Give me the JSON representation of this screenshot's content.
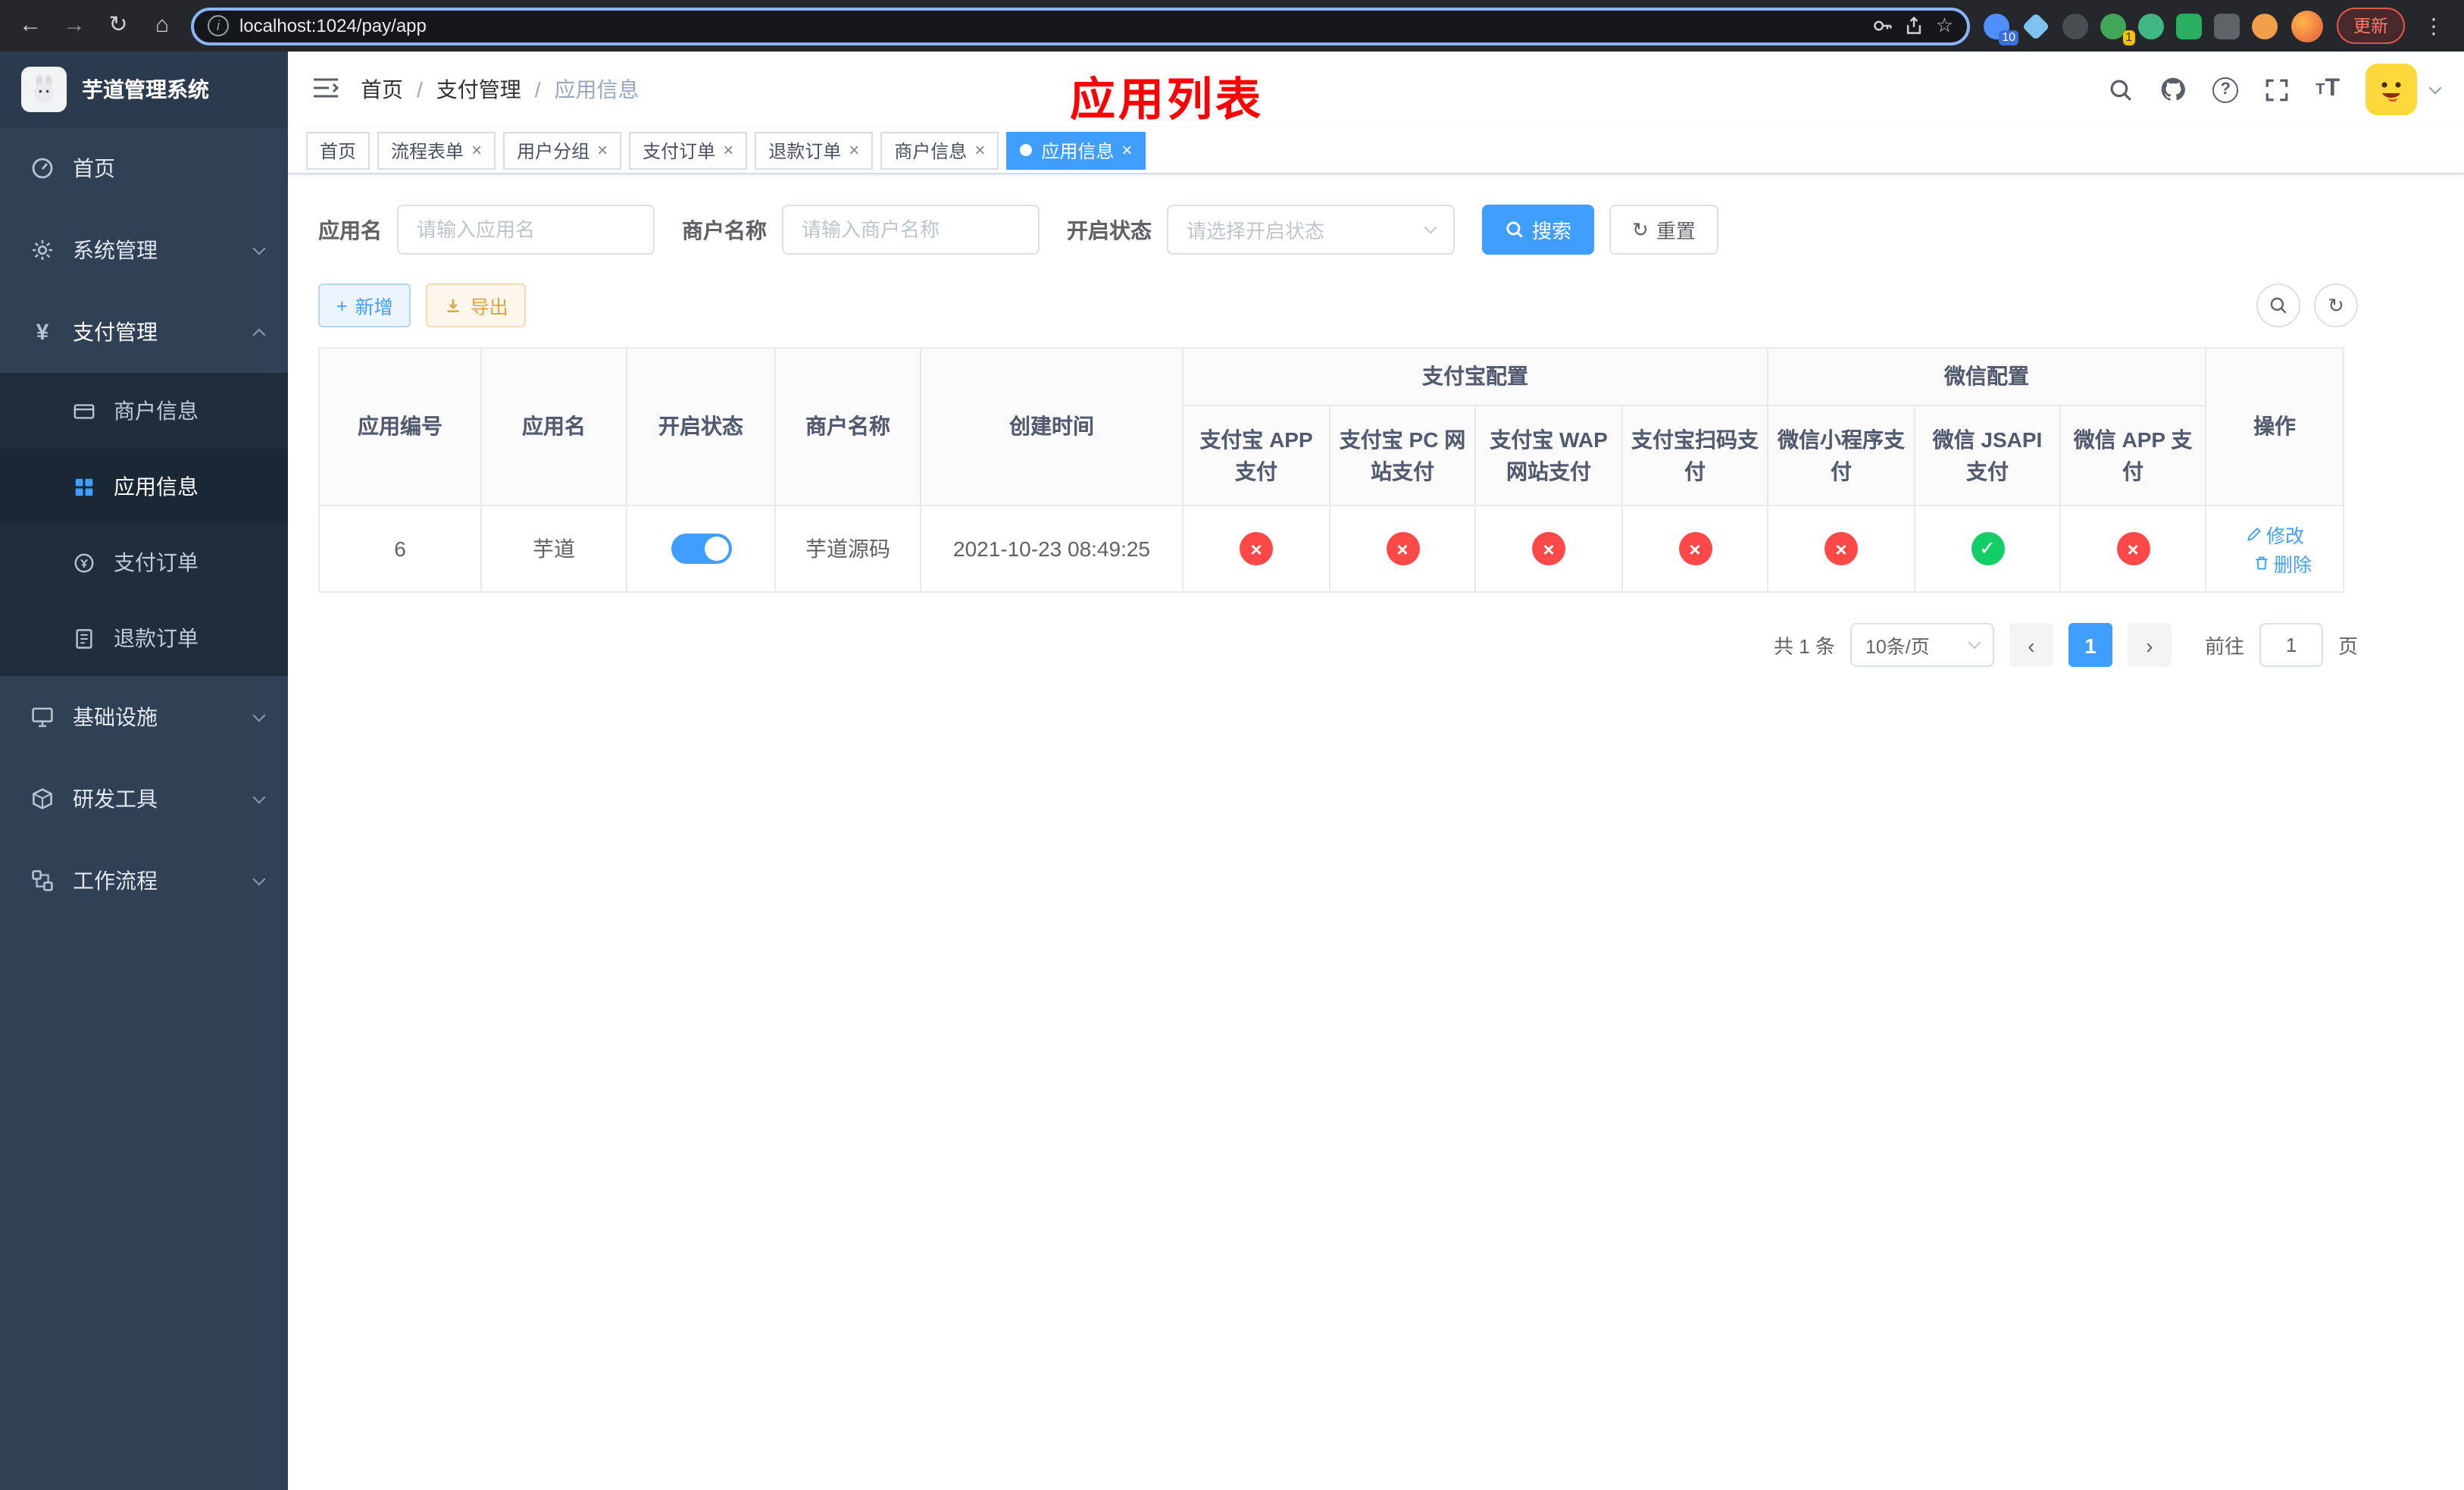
{
  "colors": {
    "accent": "#409eff",
    "success": "#13ce66",
    "danger": "#ff4949",
    "warning": "#e6a23c",
    "sidebar_bg": "#304156",
    "submenu_bg": "#1f2d3d",
    "annotation": "#ff0000"
  },
  "browser": {
    "url": "localhost:1024/pay/app",
    "update_label": "更新",
    "extension_badge_count": "10",
    "whale_badge_count": "1"
  },
  "sidebar": {
    "logo_title": "芋道管理系统",
    "items": [
      {
        "label": "首页"
      },
      {
        "label": "系统管理"
      },
      {
        "label": "支付管理"
      },
      {
        "label": "基础设施"
      },
      {
        "label": "研发工具"
      },
      {
        "label": "工作流程"
      }
    ],
    "payment_children": [
      {
        "label": "商户信息"
      },
      {
        "label": "应用信息"
      },
      {
        "label": "支付订单"
      },
      {
        "label": "退款订单"
      }
    ]
  },
  "header": {
    "breadcrumb": [
      "首页",
      "支付管理",
      "应用信息"
    ],
    "annotation": "应用列表"
  },
  "tabs": [
    {
      "label": "首页"
    },
    {
      "label": "流程表单"
    },
    {
      "label": "用户分组"
    },
    {
      "label": "支付订单"
    },
    {
      "label": "退款订单"
    },
    {
      "label": "商户信息"
    },
    {
      "label": "应用信息"
    }
  ],
  "filters": {
    "app_name_label": "应用名",
    "app_name_placeholder": "请输入应用名",
    "merchant_label": "商户名称",
    "merchant_placeholder": "请输入商户名称",
    "status_label": "开启状态",
    "status_placeholder": "请选择开启状态",
    "search_label": "搜索",
    "reset_label": "重置"
  },
  "toolbar": {
    "add_label": "新增",
    "export_label": "导出"
  },
  "table": {
    "col_app_id": "应用编号",
    "col_app_name": "应用名",
    "col_status": "开启状态",
    "col_merchant": "商户名称",
    "col_created": "创建时间",
    "col_ops": "操作",
    "group_alipay": "支付宝配置",
    "group_wechat": "微信配置",
    "col_alipay_app": "支付宝 APP 支付",
    "col_alipay_pc": "支付宝 PC 网站支付",
    "col_alipay_wap": "支付宝 WAP 网站支付",
    "col_alipay_scan": "支付宝扫码支付",
    "col_wx_mini": "微信小程序支付",
    "col_wx_jsapi": "微信 JSAPI 支付",
    "col_wx_app": "微信 APP 支付",
    "row": {
      "id": "6",
      "name": "芋道",
      "enabled": true,
      "merchant": "芋道源码",
      "created": "2021-10-23 08:49:25",
      "alipay_app": false,
      "alipay_pc": false,
      "alipay_wap": false,
      "alipay_scan": false,
      "wx_mini": false,
      "wx_jsapi": true,
      "wx_app": false,
      "op_edit": "修改",
      "op_delete": "删除"
    }
  },
  "pagination": {
    "total": "共 1 条",
    "page_size": "10条/页",
    "page": "1",
    "goto_label": "前往",
    "goto_value": "1",
    "page_unit": "页"
  }
}
